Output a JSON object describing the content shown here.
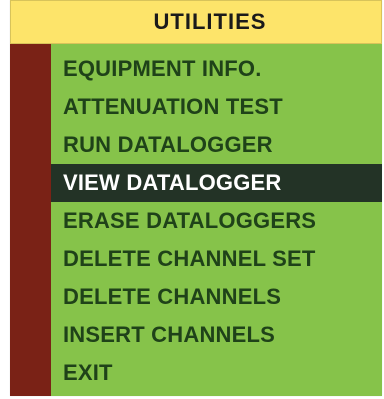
{
  "title": "UTILITIES",
  "colors": {
    "title_bg": "#fde46a",
    "menu_bg": "#86c34a",
    "left_strip": "#7a2216",
    "text": "#1f4219",
    "selected_bg": "#233326",
    "selected_text": "#ffffff"
  },
  "menu": {
    "items": [
      {
        "label": "EQUIPMENT INFO.",
        "selected": false
      },
      {
        "label": "ATTENUATION TEST",
        "selected": false
      },
      {
        "label": "RUN DATALOGGER",
        "selected": false
      },
      {
        "label": "VIEW DATALOGGER",
        "selected": true
      },
      {
        "label": "ERASE DATALOGGERS",
        "selected": false
      },
      {
        "label": "DELETE CHANNEL SET",
        "selected": false
      },
      {
        "label": "DELETE CHANNELS",
        "selected": false
      },
      {
        "label": "INSERT CHANNELS",
        "selected": false
      },
      {
        "label": "EXIT",
        "selected": false
      }
    ]
  }
}
